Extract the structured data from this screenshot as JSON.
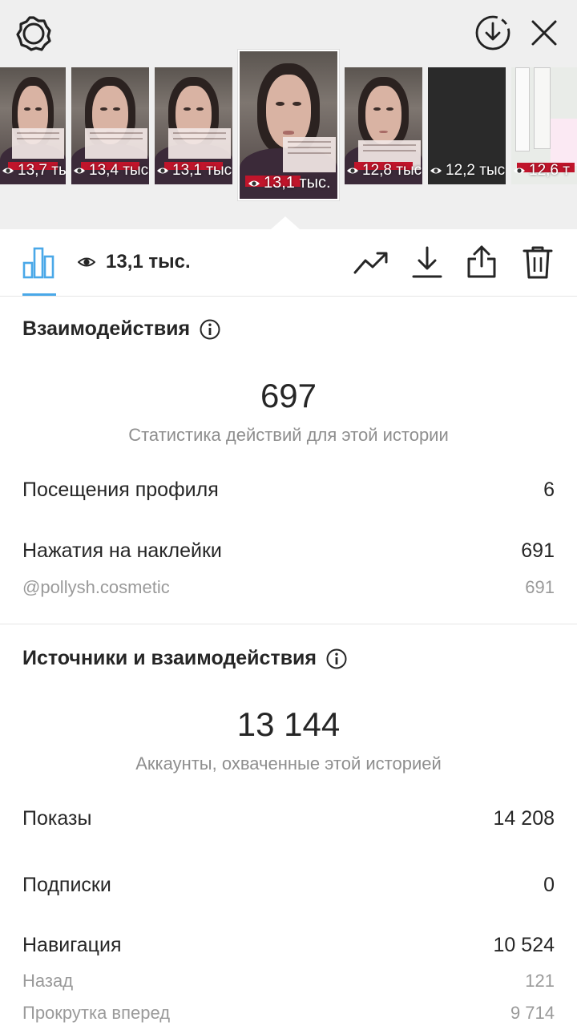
{
  "top_bar": {
    "settings_icon": "settings-gear-icon",
    "download_icon": "download-circle-icon",
    "close_icon": "close-icon"
  },
  "stories": [
    {
      "views": "13,7 тыс",
      "kind": "face"
    },
    {
      "views": "13,4 тыс",
      "kind": "face"
    },
    {
      "views": "13,1 тыс",
      "kind": "face"
    },
    {
      "views": "13,1 тыс.",
      "kind": "face",
      "selected": true
    },
    {
      "views": "12,8 тыс",
      "kind": "face"
    },
    {
      "views": "12,2 тыс",
      "kind": "dark"
    },
    {
      "views": "12,6 т",
      "kind": "products"
    }
  ],
  "toolbar": {
    "views_label": "13,1 тыс.",
    "icons": [
      "bar-chart-icon",
      "eye-icon",
      "trending-icon",
      "download-icon",
      "share-icon",
      "trash-icon"
    ]
  },
  "interactions": {
    "title": "Взаимодействия",
    "total": "697",
    "subtitle": "Статистика действий для этой истории",
    "rows": [
      {
        "label": "Посещения профиля",
        "value": "6"
      },
      {
        "label": "Нажатия на наклейки",
        "value": "691"
      }
    ],
    "sub_rows": [
      {
        "label": "@pollysh.cosmetic",
        "value": "691"
      }
    ]
  },
  "discovery": {
    "title": "Источники и взаимодействия",
    "total": "13 144",
    "subtitle": "Аккаунты, охваченные этой историей",
    "rows": [
      {
        "label": "Показы",
        "value": "14 208"
      },
      {
        "label": "Подписки",
        "value": "0"
      },
      {
        "label": "Навигация",
        "value": "10 524"
      }
    ],
    "sub_rows": [
      {
        "label": "Назад",
        "value": "121"
      },
      {
        "label": "Прокрутка вперед",
        "value": "9 714"
      }
    ]
  },
  "colors": {
    "accent_blue": "#4aa8e8",
    "story_red": "#c0152b",
    "muted_text": "#8e8e8e"
  }
}
